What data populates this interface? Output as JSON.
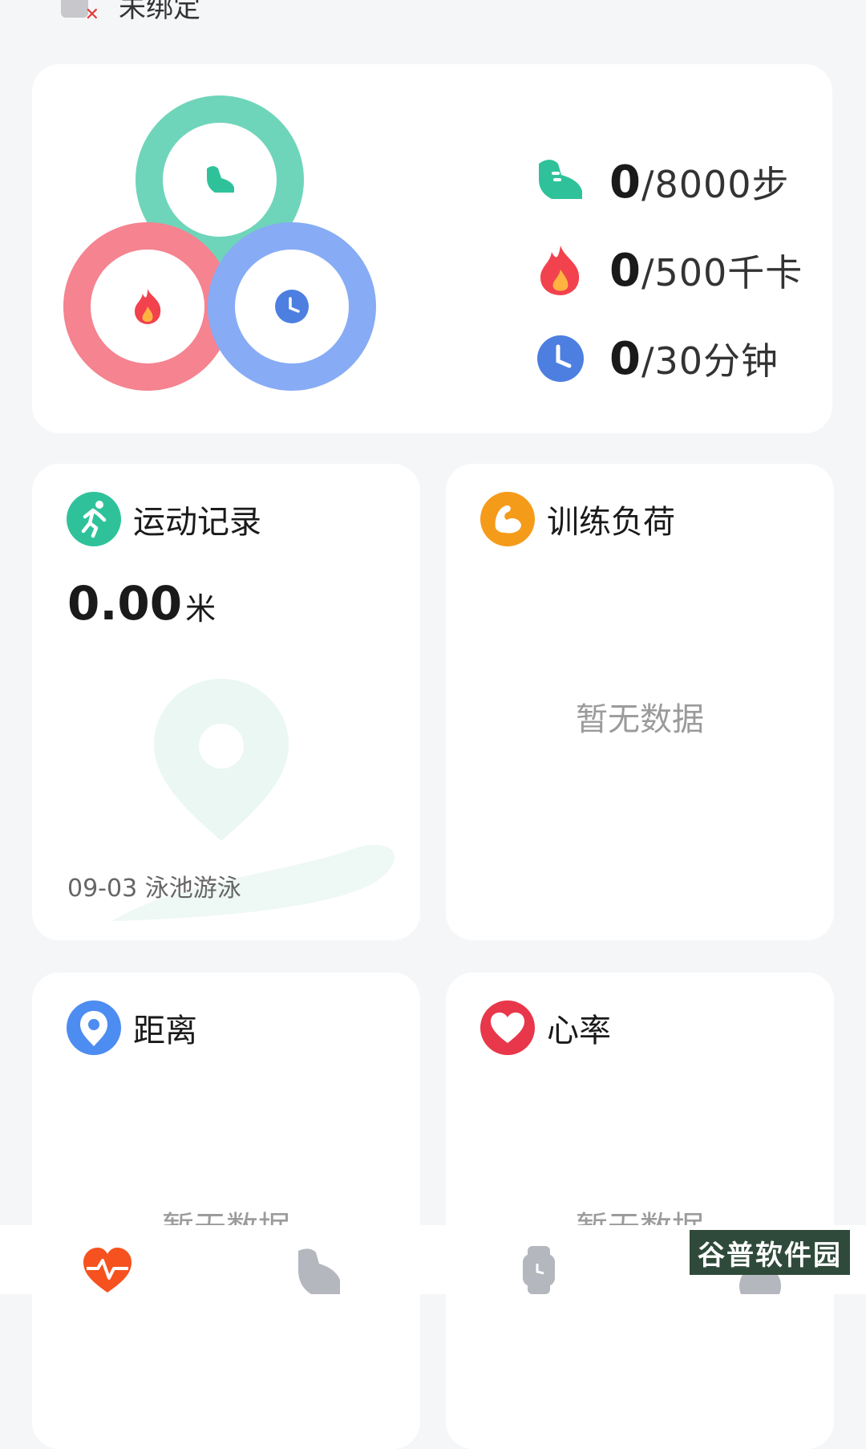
{
  "device": {
    "status": "未绑定"
  },
  "goals": [
    {
      "icon": "shoe-icon",
      "current": "0",
      "target": "/8000步",
      "color": "#2fc29a"
    },
    {
      "icon": "flame-icon",
      "current": "0",
      "target": "/500千卡",
      "color": "#f2424e"
    },
    {
      "icon": "clock-icon",
      "current": "0",
      "target": "/30分钟",
      "color": "#4d7fe0"
    }
  ],
  "tiles": {
    "workout": {
      "title": "运动记录",
      "value": "0.00",
      "unit": "米",
      "last": "09-03 泳池游泳",
      "icon": "runner-icon"
    },
    "training_load": {
      "title": "训练负荷",
      "empty": "暂无数据",
      "icon": "muscle-icon"
    },
    "distance": {
      "title": "距离",
      "empty": "暂无数据",
      "icon": "location-pin-icon"
    },
    "heart_rate": {
      "title": "心率",
      "empty": "暂无数据",
      "icon": "heart-icon"
    }
  },
  "nav": [
    {
      "name": "health",
      "icon": "heartbeat-icon",
      "active": true
    },
    {
      "name": "sport",
      "icon": "shoe-icon"
    },
    {
      "name": "device",
      "icon": "watch-icon"
    },
    {
      "name": "me",
      "icon": "profile-icon"
    }
  ],
  "watermark": "谷普软件园",
  "colors": {
    "steps": "#2fc29a",
    "calories": "#f2424e",
    "minutes": "#4d7fe0",
    "accent": "#f5521f"
  }
}
